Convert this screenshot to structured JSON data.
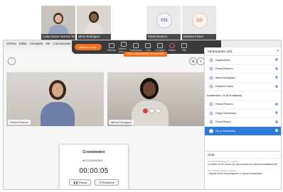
{
  "top_participants": [
    {
      "name": "Luisa Koone Herrera Tor...",
      "type": "video"
    },
    {
      "name": "Mirna Rodriguez",
      "type": "video"
    },
    {
      "name": "Flavia Romero",
      "initials": "FR",
      "type": "initials"
    },
    {
      "name": "Roberta Flores",
      "initials": "RF",
      "type": "initials"
    }
  ],
  "menubar": {
    "items": [
      "Archivo",
      "Editar",
      "Compartir",
      "Ver",
      "Comunicarse",
      "Reunión",
      "Participante",
      "Ayuda"
    ]
  },
  "toolbar": {
    "stop_label": "Detener comp...",
    "items": [
      "Silenciar",
      "Detener video",
      "Participantes",
      "Chat",
      "Compartir",
      "Grabar",
      "Más"
    ],
    "share_banner": "Está compartiendo su contenido"
  },
  "stage": {
    "video_left_name": "Flavia Romero",
    "video_right_name": "Mirna Rodriguez",
    "ctrl_left": "↑",
    "ctrl_right_a": "⊞",
    "ctrl_right_b": "≡"
  },
  "stopwatch": {
    "title": "Cronómetro",
    "status": "● Cronómetro...",
    "time": "00:00:05",
    "pause_label": "❚❚ Pausa",
    "reset_label": "↺ Restaurar"
  },
  "participants_panel": {
    "title": "Participantes (10)",
    "items": [
      {
        "name": "Organizador",
        "kind": "user"
      },
      {
        "name": "Flavia Romero",
        "kind": "user"
      },
      {
        "name": "Mirna Rodriguez",
        "kind": "user"
      },
      {
        "name": "Roberta Flores",
        "kind": "user"
      },
      {
        "name": "Asistentes: 10 (5 invitados)",
        "kind": "group"
      },
      {
        "name": "Flavia Romero",
        "kind": "user"
      },
      {
        "name": "Diego Hernández",
        "kind": "user"
      },
      {
        "name": "Paola Rivera",
        "kind": "user"
      },
      {
        "name": "Sony Hernández",
        "kind": "selected"
      }
    ]
  },
  "chat": {
    "title": "Chat",
    "messages": [
      {
        "meta": "De Mirna Rodriguez a todos:",
        "text": "Lo antes con el correo de reproducción lo subirá inmediatamente."
      },
      {
        "meta": "De Roberta Flores a todos:",
        "text": "¿Alguien tiene otra pregunta? lo quedó claramente."
      }
    ]
  }
}
